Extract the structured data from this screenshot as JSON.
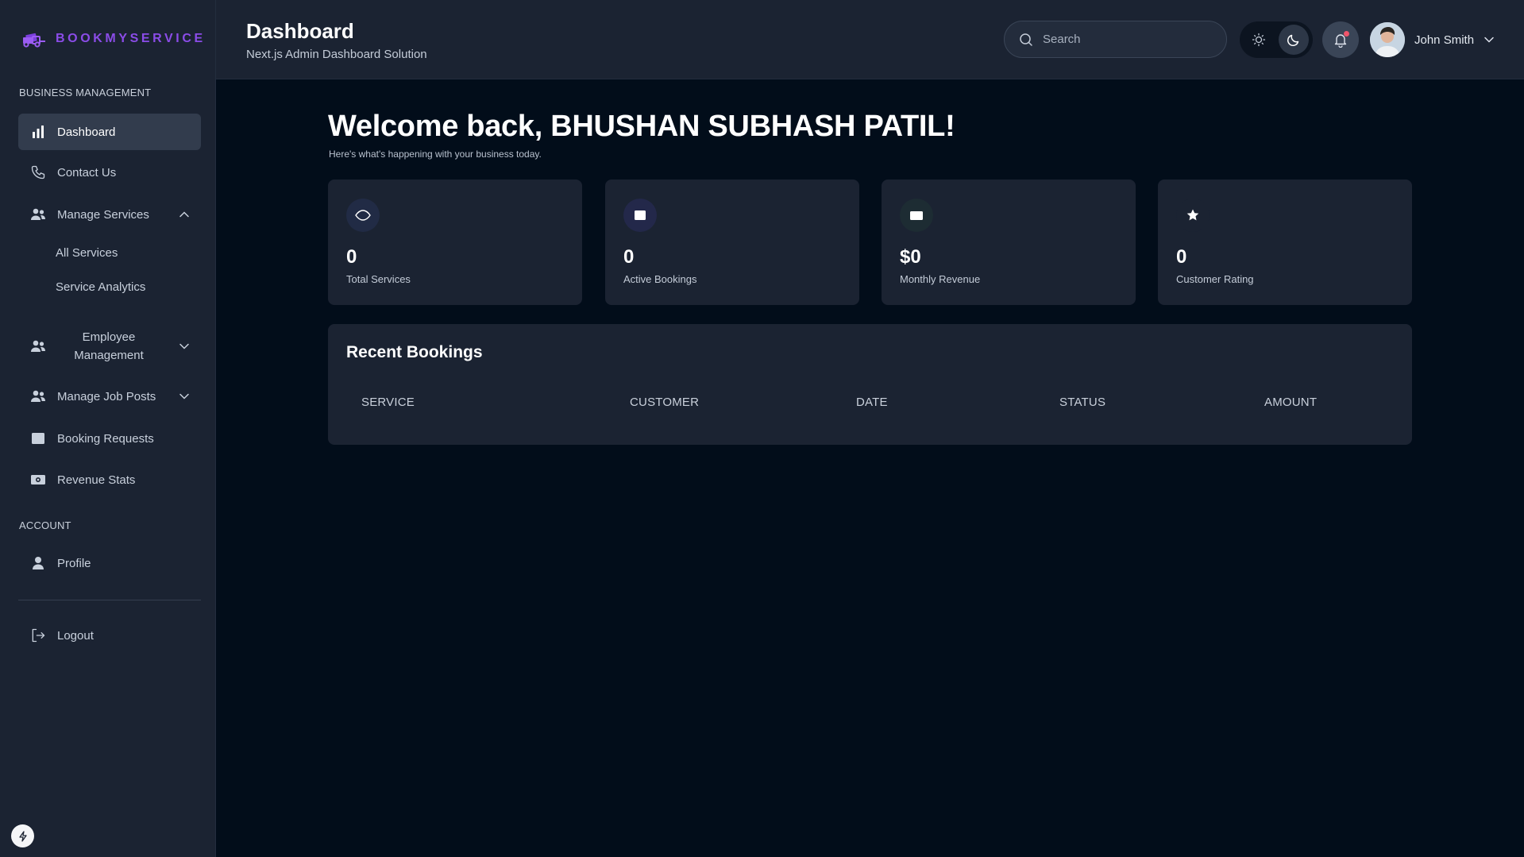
{
  "brand": {
    "name": "BOOKMYSERVICE",
    "color": "#8b4ce8"
  },
  "sidebar": {
    "sections": {
      "business": "BUSINESS MANAGEMENT",
      "account": "ACCOUNT"
    },
    "items": {
      "dashboard": "Dashboard",
      "contact": "Contact Us",
      "manage_services": "Manage Services",
      "all_services": "All Services",
      "service_analytics": "Service Analytics",
      "employee_management": "Employee Management",
      "manage_job_posts": "Manage Job Posts",
      "booking_requests": "Booking Requests",
      "revenue_stats": "Revenue Stats",
      "profile": "Profile",
      "logout": "Logout"
    }
  },
  "header": {
    "title": "Dashboard",
    "subtitle": "Next.js Admin Dashboard Solution",
    "search_placeholder": "Search",
    "user_name": "John Smith"
  },
  "main": {
    "welcome": "Welcome back, BHUSHAN SUBHASH PATIL!",
    "welcome_sub": "Here's what's happening with your business today.",
    "stats": [
      {
        "value": "0",
        "label": "Total Services",
        "icon": "eye-icon"
      },
      {
        "value": "0",
        "label": "Active Bookings",
        "icon": "calendar-icon"
      },
      {
        "value": "$0",
        "label": "Monthly Revenue",
        "icon": "money-icon"
      },
      {
        "value": "0",
        "label": "Customer Rating",
        "icon": "star-icon"
      }
    ],
    "recent_bookings": {
      "title": "Recent Bookings",
      "columns": [
        "SERVICE",
        "CUSTOMER",
        "DATE",
        "STATUS",
        "AMOUNT"
      ]
    }
  },
  "colors": {
    "page_bg": "#020d1a",
    "panel_bg": "#1b2332",
    "active_item_bg": "#323c4d",
    "notification_dot": "#f0556b"
  }
}
